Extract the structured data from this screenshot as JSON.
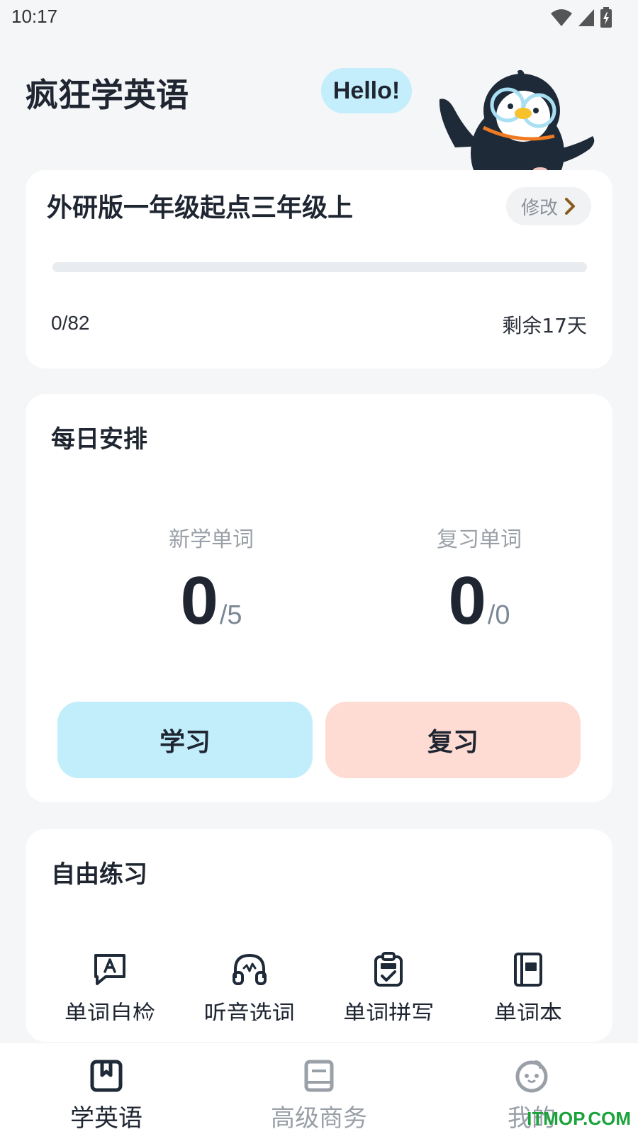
{
  "status_bar": {
    "time": "10:17",
    "icons": [
      "wifi-icon",
      "signal-icon",
      "battery-icon"
    ]
  },
  "header": {
    "title": "疯狂学英语",
    "greeting": "Hello!"
  },
  "book": {
    "title": "外研版一年级起点三年级上",
    "modify_label": "修改",
    "progress_text": "0/82",
    "progress_fraction": 0,
    "days_left": "剩余17天"
  },
  "plan": {
    "title": "每日安排",
    "new_words": {
      "label": "新学单词",
      "value": "0",
      "total": "/5"
    },
    "review_words": {
      "label": "复习单词",
      "value": "0",
      "total": "/0"
    },
    "learn_button": "学习",
    "review_button": "复习"
  },
  "practice": {
    "title": "自由练习",
    "items": [
      {
        "label": "单词自检",
        "icon": "word-check-icon"
      },
      {
        "label": "听音选词",
        "icon": "headphones-icon"
      },
      {
        "label": "单词拼写",
        "icon": "clipboard-abc-icon"
      },
      {
        "label": "单词本",
        "icon": "notebook-icon"
      }
    ]
  },
  "nav": {
    "items": [
      {
        "label": "学英语",
        "icon": "bookmark-book-icon",
        "active": true
      },
      {
        "label": "高级商务",
        "icon": "book-icon",
        "active": false
      },
      {
        "label": "我的",
        "icon": "smiley-face-icon",
        "active": false
      }
    ]
  },
  "watermark": "ITMOP.COM",
  "colors": {
    "background": "#f5f6f8",
    "learn_button": "#c2eefb",
    "review_button": "#fedcd3",
    "hello_bubble": "#c4eefb",
    "text_primary": "#1f2632",
    "text_muted": "#9aa0a8"
  }
}
